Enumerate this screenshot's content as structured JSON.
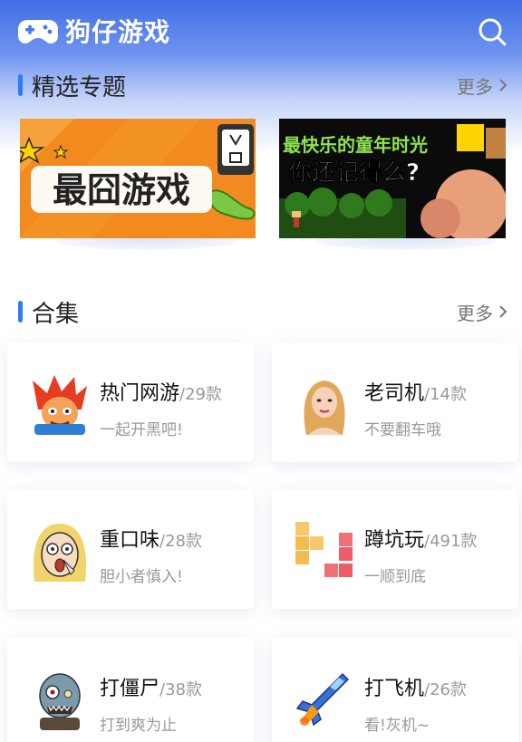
{
  "header": {
    "title": "狗仔游戏"
  },
  "featured": {
    "title": "精选专题",
    "more": "更多",
    "banners": [
      {
        "text": "最囧游戏"
      },
      {
        "text_line1": "最快乐的童年时光",
        "text_line2": "你还记得么?"
      }
    ]
  },
  "collections": {
    "title": "合集",
    "more": "更多",
    "items": [
      {
        "name": "热门网游",
        "count": "/29款",
        "desc": "一起开黑吧!"
      },
      {
        "name": "老司机",
        "count": "/14款",
        "desc": "不要翻车哦"
      },
      {
        "name": "重口味",
        "count": "/28款",
        "desc": "胆小者慎入!"
      },
      {
        "name": "蹲坑玩",
        "count": "/491款",
        "desc": "一顺到底"
      },
      {
        "name": "打僵尸",
        "count": "/38款",
        "desc": "打到爽为止"
      },
      {
        "name": "打飞机",
        "count": "/26款",
        "desc": "看!灰机~"
      }
    ]
  },
  "colors": {
    "accent": "#2f7bf5",
    "header": "#3f6fe6"
  }
}
